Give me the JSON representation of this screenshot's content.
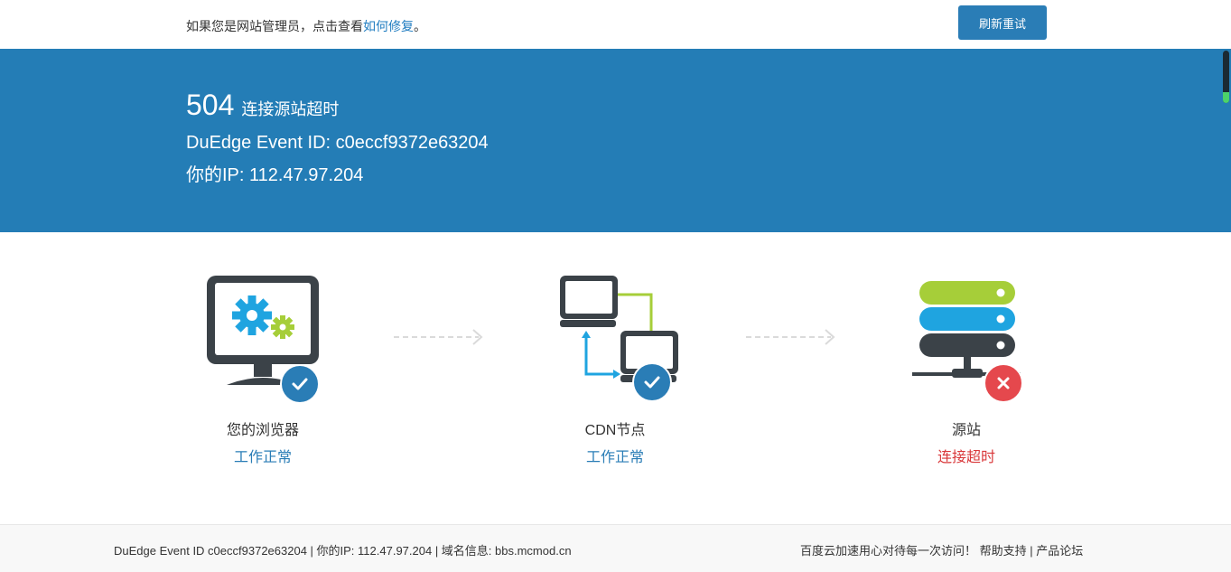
{
  "topbar": {
    "notice_prefix": "如果您是网站管理员，点击查看",
    "notice_link": "如何修复",
    "notice_suffix": "。",
    "refresh_label": "刷新重试"
  },
  "banner": {
    "code": "504",
    "code_text": "连接源站超时",
    "event_id": "DuEdge Event ID: c0eccf9372e63204",
    "ip": "你的IP: 112.47.97.204"
  },
  "nodes": [
    {
      "name": "您的浏览器",
      "status": "工作正常",
      "icon": "browser-monitor-icon",
      "badge": "check-icon"
    },
    {
      "name": "CDN节点",
      "status": "工作正常",
      "icon": "cdn-network-icon",
      "badge": "check-icon"
    },
    {
      "name": "源站",
      "status": "连接超时",
      "icon": "server-icon",
      "badge": "cross-icon"
    }
  ],
  "colors": {
    "banner": "#247db6",
    "ok": "#2a7db6",
    "error": "#d9383a",
    "green": "#a6ce39",
    "cyan": "#1fa4e0",
    "dark": "#3b4248"
  },
  "footer": {
    "info": "DuEdge Event ID c0eccf9372e63204 | 你的IP: 112.47.97.204 | 域名信息: bbs.mcmod.cn",
    "slogan": "百度云加速用心对待每一次访问！",
    "help_link": "帮助支持",
    "separator": " | ",
    "forum_link": "产品论坛"
  }
}
